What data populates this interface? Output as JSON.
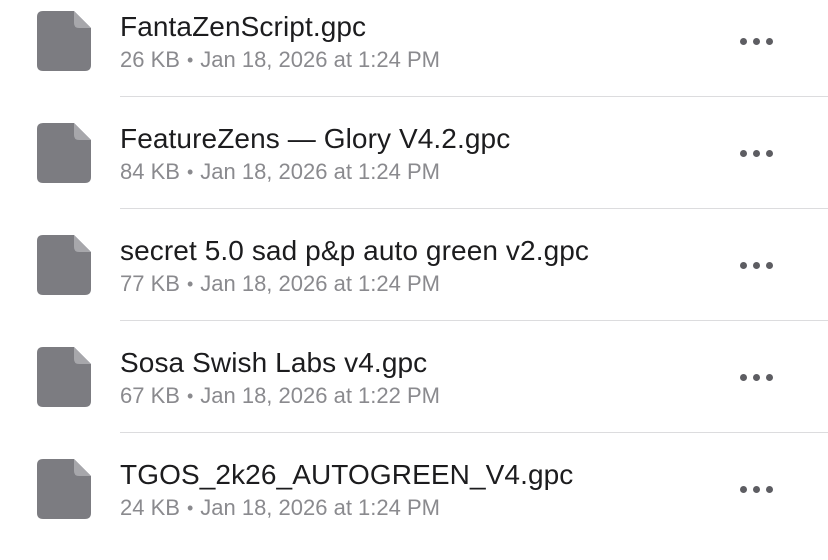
{
  "files": [
    {
      "name": "FantaZenScript.gpc",
      "size": "26 KB",
      "date": "Jan 18, 2026 at 1:24 PM"
    },
    {
      "name": "FeatureZens — Glory V4.2.gpc",
      "size": "84 KB",
      "date": "Jan 18, 2026 at 1:24 PM"
    },
    {
      "name": "secret 5.0 sad p&p auto green v2.gpc",
      "size": "77 KB",
      "date": "Jan 18, 2026 at 1:24 PM"
    },
    {
      "name": "Sosa Swish Labs v4.gpc",
      "size": "67 KB",
      "date": "Jan 18, 2026 at 1:22 PM"
    },
    {
      "name": "TGOS_2k26_AUTOGREEN_V4.gpc",
      "size": "24 KB",
      "date": "Jan 18, 2026 at 1:24 PM"
    }
  ],
  "meta_separator": "•",
  "icons": {
    "file": "document-icon",
    "more": "ellipsis-icon"
  },
  "colors": {
    "file_icon": "#7c7c81",
    "file_icon_fold": "#a7a7ab",
    "name_text": "#1c1c1e",
    "meta_text": "#8a8a8e",
    "more_dots": "#5d5d62",
    "divider": "#dcdcde"
  }
}
